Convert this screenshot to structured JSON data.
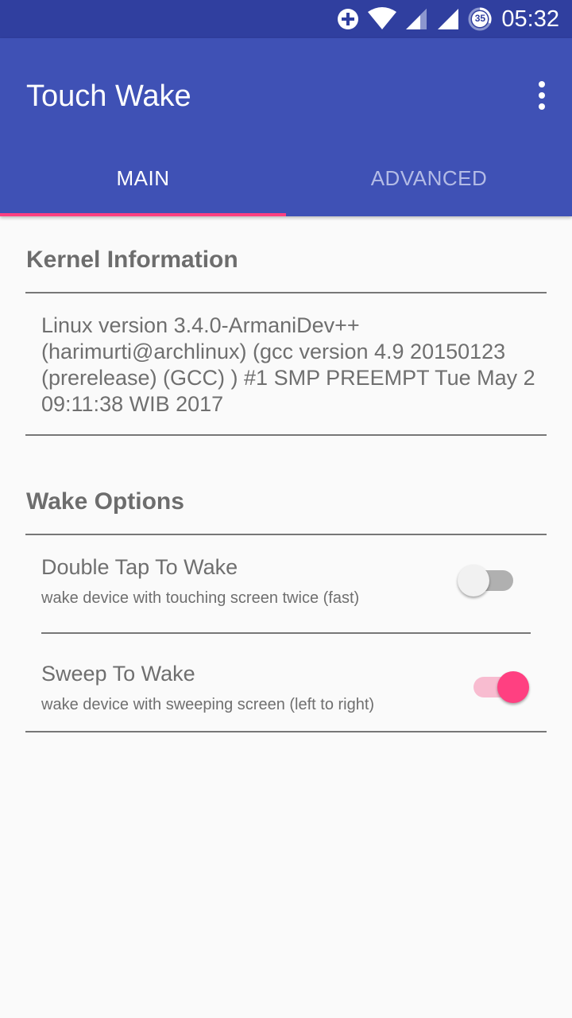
{
  "status_bar": {
    "time": "05:32",
    "icons": [
      "data-saver-icon",
      "wifi-icon",
      "signal-icon",
      "signal-icon",
      "battery-icon"
    ],
    "battery_badge": "35"
  },
  "app_bar": {
    "title": "Touch Wake",
    "overflow_icon": "more-vert-icon"
  },
  "tabs": [
    {
      "label": "MAIN",
      "selected": true
    },
    {
      "label": "ADVANCED",
      "selected": false
    }
  ],
  "kernel": {
    "section_title": "Kernel Information",
    "version_text": "Linux version 3.4.0-ArmaniDev++ (harimurti@archlinux) (gcc version 4.9 20150123 (prerelease) (GCC) ) #1 SMP PREEMPT Tue May 2 09:11:38 WIB 2017"
  },
  "wake_options": {
    "section_title": "Wake Options",
    "items": [
      {
        "title": "Double Tap To Wake",
        "subtitle": "wake device with touching screen twice (fast)",
        "enabled": false
      },
      {
        "title": "Sweep To Wake",
        "subtitle": "wake device with sweeping screen (left to right)",
        "enabled": true
      }
    ]
  },
  "colors": {
    "primary": "#3f51b5",
    "primary_dark": "#303f9f",
    "accent": "#ff4081",
    "background": "#fafafa"
  }
}
